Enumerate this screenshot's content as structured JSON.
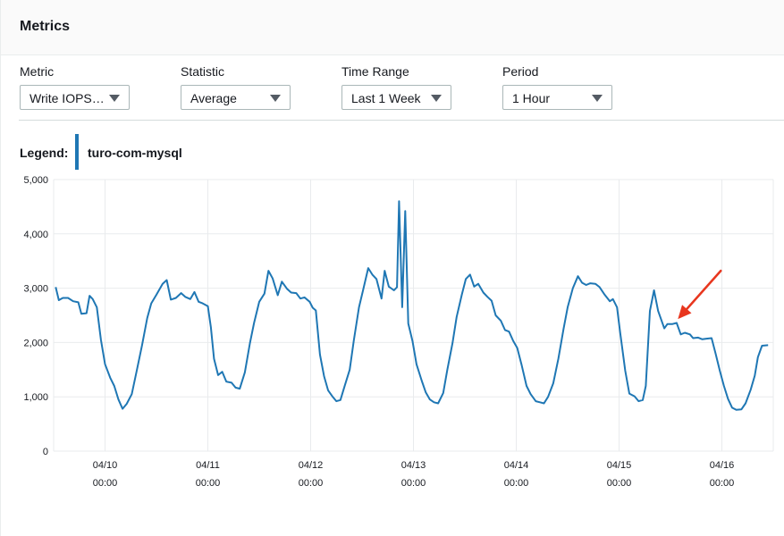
{
  "header": {
    "title": "Metrics"
  },
  "controls": [
    {
      "label": "Metric",
      "value": "Write IOPS…"
    },
    {
      "label": "Statistic",
      "value": "Average"
    },
    {
      "label": "Time Range",
      "value": "Last 1 Week"
    },
    {
      "label": "Period",
      "value": "1 Hour"
    }
  ],
  "legend": {
    "label": "Legend:",
    "series_name": "turo-com-mysql"
  },
  "colors": {
    "series": "#1f77b4",
    "annotation_arrow": "#e8361e",
    "grid": "#e9ebed"
  },
  "chart_data": {
    "type": "line",
    "title": "",
    "xlabel": "",
    "ylabel": "",
    "ylim": [
      0,
      5000
    ],
    "xlim": [
      9.5,
      16.5
    ],
    "x_unit": "days (April)",
    "yticks": [
      "0",
      "1,000",
      "2,000",
      "3,000",
      "4,000",
      "5,000"
    ],
    "xticks": [
      {
        "x": 10,
        "date": "04/10",
        "time": "00:00"
      },
      {
        "x": 11,
        "date": "04/11",
        "time": "00:00"
      },
      {
        "x": 12,
        "date": "04/12",
        "time": "00:00"
      },
      {
        "x": 13,
        "date": "04/13",
        "time": "00:00"
      },
      {
        "x": 14,
        "date": "04/14",
        "time": "00:00"
      },
      {
        "x": 15,
        "date": "04/15",
        "time": "00:00"
      },
      {
        "x": 16,
        "date": "04/16",
        "time": "00:00"
      }
    ],
    "grid": true,
    "legend_position": "top-left",
    "annotation": {
      "type": "arrow",
      "points_to_x": 15.52,
      "points_to_y": 2350
    },
    "series": [
      {
        "name": "turo-com-mysql",
        "points": [
          [
            9.52,
            3020
          ],
          [
            9.55,
            2780
          ],
          [
            9.59,
            2820
          ],
          [
            9.64,
            2820
          ],
          [
            9.69,
            2760
          ],
          [
            9.74,
            2740
          ],
          [
            9.77,
            2530
          ],
          [
            9.82,
            2540
          ],
          [
            9.85,
            2860
          ],
          [
            9.88,
            2800
          ],
          [
            9.92,
            2650
          ],
          [
            9.96,
            2050
          ],
          [
            10.0,
            1600
          ],
          [
            10.05,
            1350
          ],
          [
            10.09,
            1200
          ],
          [
            10.13,
            950
          ],
          [
            10.17,
            780
          ],
          [
            10.21,
            870
          ],
          [
            10.26,
            1050
          ],
          [
            10.31,
            1500
          ],
          [
            10.36,
            1950
          ],
          [
            10.41,
            2450
          ],
          [
            10.45,
            2720
          ],
          [
            10.5,
            2880
          ],
          [
            10.56,
            3080
          ],
          [
            10.6,
            3150
          ],
          [
            10.64,
            2790
          ],
          [
            10.69,
            2820
          ],
          [
            10.74,
            2910
          ],
          [
            10.78,
            2840
          ],
          [
            10.83,
            2800
          ],
          [
            10.87,
            2930
          ],
          [
            10.91,
            2750
          ],
          [
            10.95,
            2720
          ],
          [
            11.0,
            2670
          ],
          [
            11.03,
            2280
          ],
          [
            11.06,
            1700
          ],
          [
            11.1,
            1400
          ],
          [
            11.14,
            1460
          ],
          [
            11.18,
            1280
          ],
          [
            11.23,
            1260
          ],
          [
            11.27,
            1170
          ],
          [
            11.31,
            1150
          ],
          [
            11.36,
            1450
          ],
          [
            11.41,
            1990
          ],
          [
            11.45,
            2360
          ],
          [
            11.5,
            2750
          ],
          [
            11.55,
            2900
          ],
          [
            11.59,
            3320
          ],
          [
            11.63,
            3180
          ],
          [
            11.68,
            2870
          ],
          [
            11.72,
            3120
          ],
          [
            11.77,
            2990
          ],
          [
            11.81,
            2920
          ],
          [
            11.86,
            2910
          ],
          [
            11.9,
            2810
          ],
          [
            11.94,
            2830
          ],
          [
            11.99,
            2750
          ],
          [
            12.02,
            2640
          ],
          [
            12.05,
            2590
          ],
          [
            12.09,
            1780
          ],
          [
            12.13,
            1380
          ],
          [
            12.17,
            1120
          ],
          [
            12.21,
            1010
          ],
          [
            12.25,
            920
          ],
          [
            12.29,
            940
          ],
          [
            12.33,
            1190
          ],
          [
            12.38,
            1500
          ],
          [
            12.42,
            2040
          ],
          [
            12.47,
            2650
          ],
          [
            12.51,
            2960
          ],
          [
            12.56,
            3370
          ],
          [
            12.6,
            3250
          ],
          [
            12.64,
            3170
          ],
          [
            12.69,
            2810
          ],
          [
            12.72,
            3320
          ],
          [
            12.76,
            3030
          ],
          [
            12.81,
            2960
          ],
          [
            12.84,
            3020
          ],
          [
            12.86,
            4600
          ],
          [
            12.89,
            2650
          ],
          [
            12.92,
            4420
          ],
          [
            12.95,
            2350
          ],
          [
            12.99,
            2030
          ],
          [
            13.03,
            1600
          ],
          [
            13.08,
            1300
          ],
          [
            13.12,
            1080
          ],
          [
            13.16,
            950
          ],
          [
            13.2,
            900
          ],
          [
            13.24,
            880
          ],
          [
            13.29,
            1070
          ],
          [
            13.33,
            1500
          ],
          [
            13.38,
            1990
          ],
          [
            13.42,
            2470
          ],
          [
            13.47,
            2880
          ],
          [
            13.51,
            3170
          ],
          [
            13.55,
            3250
          ],
          [
            13.59,
            3030
          ],
          [
            13.63,
            3080
          ],
          [
            13.68,
            2920
          ],
          [
            13.72,
            2840
          ],
          [
            13.76,
            2770
          ],
          [
            13.8,
            2500
          ],
          [
            13.85,
            2400
          ],
          [
            13.89,
            2230
          ],
          [
            13.93,
            2200
          ],
          [
            13.97,
            2030
          ],
          [
            14.01,
            1900
          ],
          [
            14.05,
            1600
          ],
          [
            14.1,
            1200
          ],
          [
            14.14,
            1050
          ],
          [
            14.19,
            920
          ],
          [
            14.23,
            900
          ],
          [
            14.27,
            880
          ],
          [
            14.31,
            1000
          ],
          [
            14.36,
            1250
          ],
          [
            14.41,
            1700
          ],
          [
            14.46,
            2250
          ],
          [
            14.5,
            2650
          ],
          [
            14.55,
            3000
          ],
          [
            14.6,
            3220
          ],
          [
            14.64,
            3100
          ],
          [
            14.68,
            3060
          ],
          [
            14.72,
            3090
          ],
          [
            14.77,
            3080
          ],
          [
            14.81,
            3020
          ],
          [
            14.86,
            2880
          ],
          [
            14.91,
            2760
          ],
          [
            14.94,
            2800
          ],
          [
            14.98,
            2650
          ],
          [
            15.01,
            2200
          ],
          [
            15.06,
            1480
          ],
          [
            15.1,
            1060
          ],
          [
            15.15,
            1010
          ],
          [
            15.19,
            920
          ],
          [
            15.23,
            940
          ],
          [
            15.26,
            1200
          ],
          [
            15.3,
            2580
          ],
          [
            15.34,
            2960
          ],
          [
            15.38,
            2580
          ],
          [
            15.44,
            2260
          ],
          [
            15.47,
            2340
          ],
          [
            15.52,
            2340
          ],
          [
            15.56,
            2360
          ],
          [
            15.6,
            2150
          ],
          [
            15.64,
            2180
          ],
          [
            15.69,
            2150
          ],
          [
            15.72,
            2080
          ],
          [
            15.77,
            2090
          ],
          [
            15.81,
            2060
          ],
          [
            15.85,
            2070
          ],
          [
            15.9,
            2080
          ],
          [
            15.94,
            1790
          ],
          [
            15.98,
            1480
          ],
          [
            16.02,
            1200
          ],
          [
            16.06,
            960
          ],
          [
            16.1,
            800
          ],
          [
            16.14,
            760
          ],
          [
            16.19,
            770
          ],
          [
            16.23,
            880
          ],
          [
            16.28,
            1130
          ],
          [
            16.32,
            1390
          ],
          [
            16.35,
            1730
          ],
          [
            16.39,
            1940
          ],
          [
            16.45,
            1950
          ]
        ]
      }
    ]
  }
}
